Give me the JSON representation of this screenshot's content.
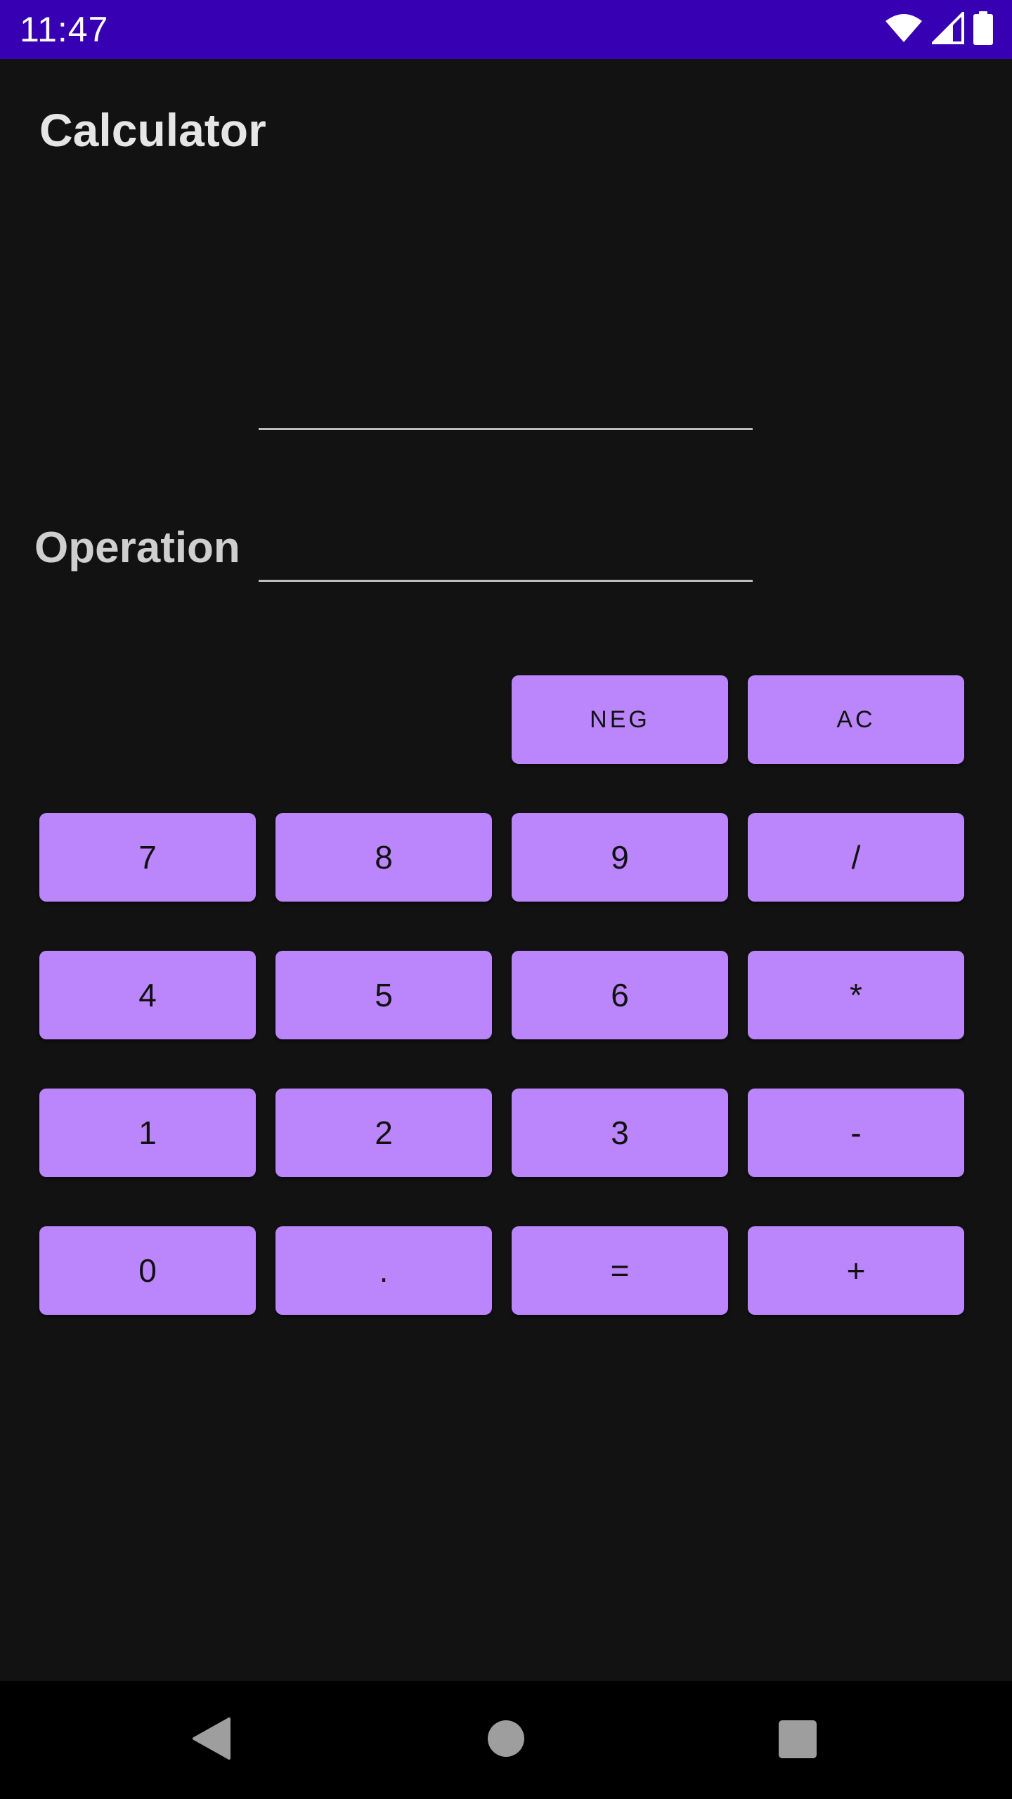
{
  "status_bar": {
    "time": "11:47",
    "background_color": "#3700b3",
    "icons": [
      "wifi-icon",
      "cellular-signal-icon",
      "battery-icon"
    ]
  },
  "app": {
    "title": "Calculator"
  },
  "result": {
    "value": ""
  },
  "operation": {
    "label": "Operation",
    "value": ""
  },
  "buttons": {
    "neg": "NEG",
    "ac": "AC",
    "seven": "7",
    "eight": "8",
    "nine": "9",
    "divide": "/",
    "four": "4",
    "five": "5",
    "six": "6",
    "multiply": "*",
    "one": "1",
    "two": "2",
    "three": "3",
    "minus": "-",
    "zero": "0",
    "dot": ".",
    "equals": "=",
    "plus": "+"
  },
  "colors": {
    "button_background": "#bb86fc",
    "screen_background": "#121212",
    "status_bar": "#3700b3"
  },
  "nav_bar": {
    "icons": [
      "back-icon",
      "home-icon",
      "recents-icon"
    ]
  }
}
